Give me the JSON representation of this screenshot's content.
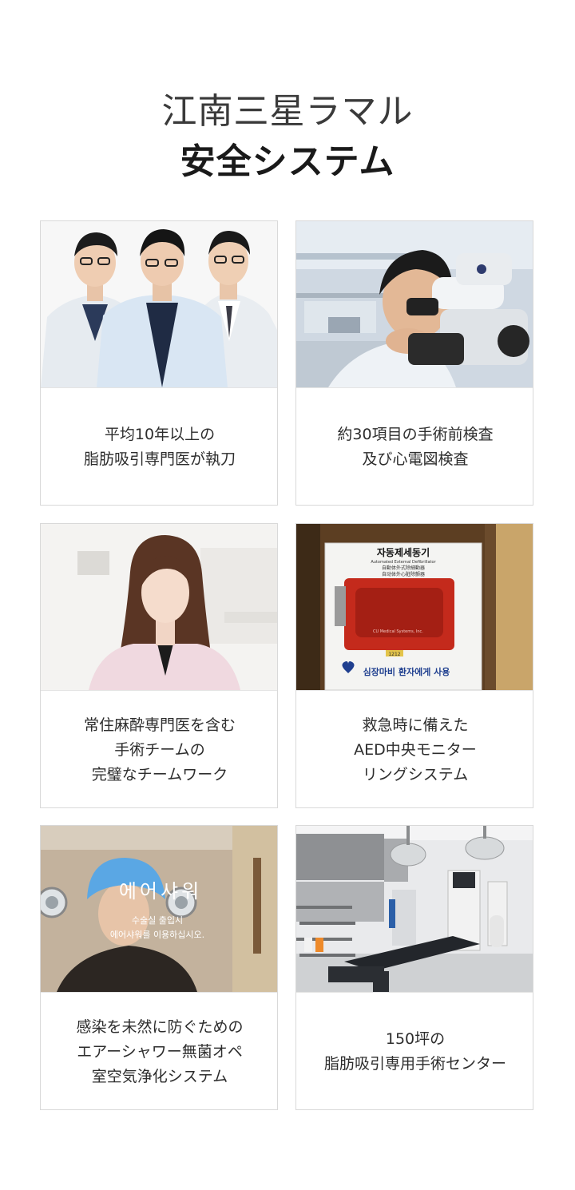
{
  "header": {
    "line1": "江南三星ラマル",
    "line2": "安全システム"
  },
  "cards": [
    {
      "lines": [
        "平均10年以上の",
        "脂肪吸引専門医が執刀"
      ]
    },
    {
      "lines": [
        "約30項目の手術前検査",
        "及び心電図検査"
      ]
    },
    {
      "lines": [
        "常住麻酔専門医を含む",
        "手術チームの",
        "完璧なチームワーク"
      ]
    },
    {
      "lines": [
        "救急時に備えた",
        "AED中央モニター",
        "リングシステム"
      ]
    },
    {
      "lines": [
        "感染を未然に防ぐための",
        "エアーシャワー無菌オペ",
        "室空気浄化システム"
      ]
    },
    {
      "lines": [
        "150坪の",
        "脂肪吸引専用手術センター"
      ]
    }
  ],
  "photo_text": {
    "aed_sign_title": "자동제세동기",
    "aed_sign_sub1": "Automated External Defibrillator",
    "aed_sign_sub2": "自動体外式除細動器",
    "aed_sign_sub3": "自动体外心脏除颤器",
    "aed_device_brand": "CU Medical Systems, Inc.",
    "aed_footer": "심장마비 환자에게 사용",
    "aed_badge": "1212",
    "airshower_title": "에어샤워",
    "airshower_line1": "수술실 출입시",
    "airshower_line2": "에어샤워를 이용하십시오."
  }
}
